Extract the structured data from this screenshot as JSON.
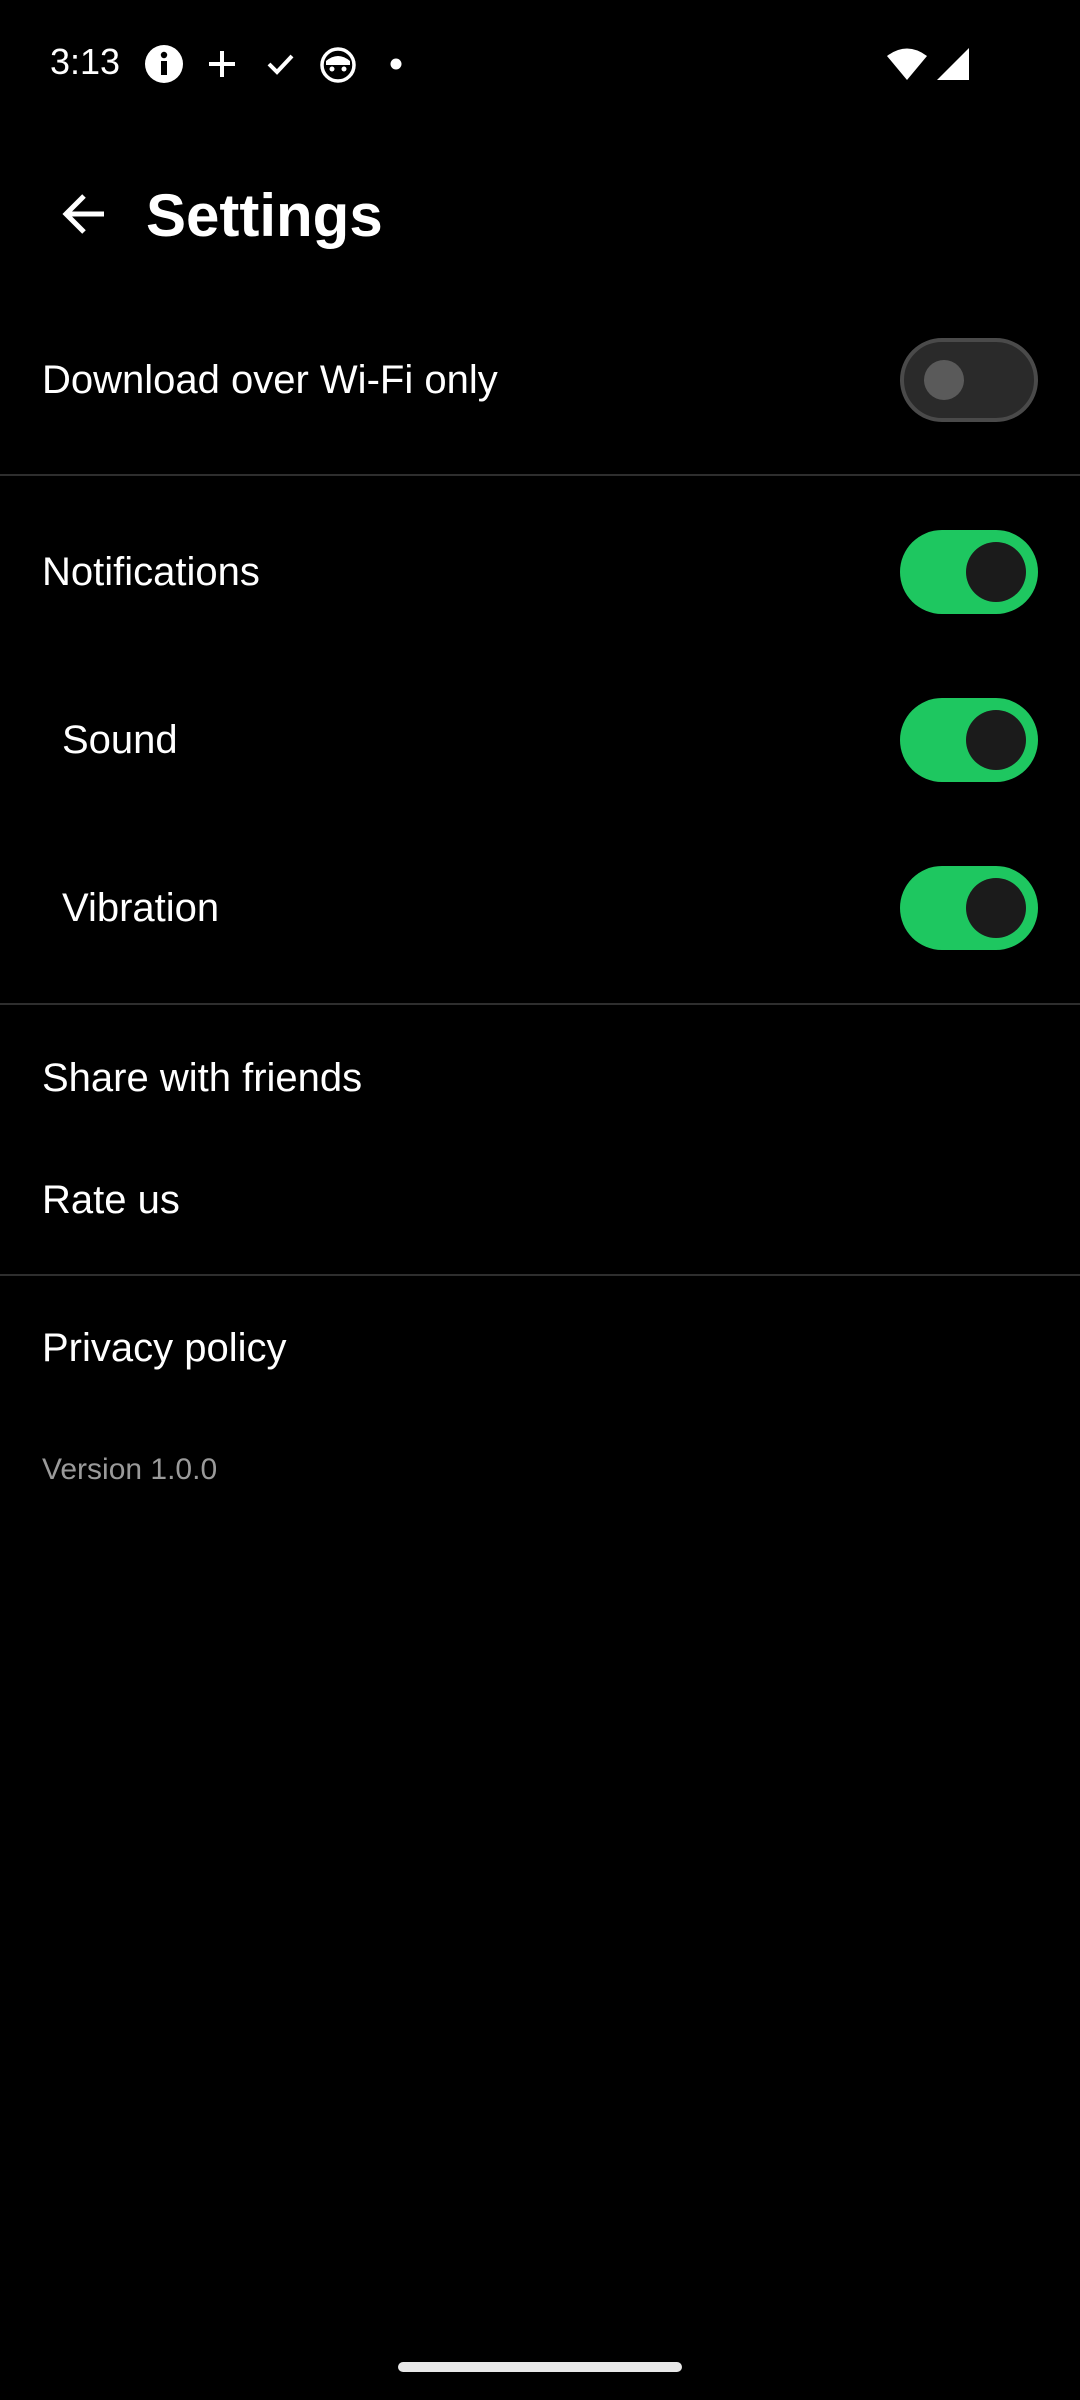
{
  "status_bar": {
    "time": "3:13",
    "left_icons": [
      "info-icon",
      "plus-icon",
      "check-icon",
      "cat-face-icon",
      "dot-icon"
    ],
    "right_icons": [
      "wifi-icon",
      "cellular-signal-icon"
    ]
  },
  "app_bar": {
    "back_icon": "arrow-left-icon",
    "title": "Settings"
  },
  "settings": {
    "wifi_only": {
      "label": "Download over Wi-Fi only",
      "enabled": false
    },
    "notifications": {
      "label": "Notifications",
      "enabled": true
    },
    "sound": {
      "label": "Sound",
      "enabled": true
    },
    "vibration": {
      "label": "Vibration",
      "enabled": true
    },
    "share": {
      "label": "Share with friends"
    },
    "rate": {
      "label": "Rate us"
    },
    "privacy": {
      "label": "Privacy policy"
    }
  },
  "footer": {
    "version": "Version 1.0.0"
  },
  "colors": {
    "background": "#000000",
    "toggle_on": "#1ec760",
    "toggle_off": "#2a2a2a",
    "text_primary": "#ffffff",
    "text_secondary": "#9a9a9a",
    "divider": "#2e2e2e"
  }
}
